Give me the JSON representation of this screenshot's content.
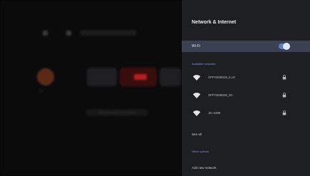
{
  "panel": {
    "title": "Network & Internet",
    "wifi_label": "Wi-Fi",
    "wifi_enabled": true,
    "available_header": "Available networks",
    "networks": [
      {
        "name": "OPPO598N36_5.1G",
        "secured": true
      },
      {
        "name": "OPPO598N36_5G",
        "secured": true
      },
      {
        "name": "Jim 5398",
        "secured": true
      }
    ],
    "see_all": "See all",
    "other_options_header": "Other options",
    "add_network": "Add new network"
  },
  "background": {
    "profile_label": "Jupy",
    "hint_text": "Customize your home screen"
  },
  "colors": {
    "panel_bg": "#1e1f23",
    "highlight_row": "#3b4052",
    "accent": "#7f9bd6",
    "toggle_on": "#5d7fbf"
  }
}
